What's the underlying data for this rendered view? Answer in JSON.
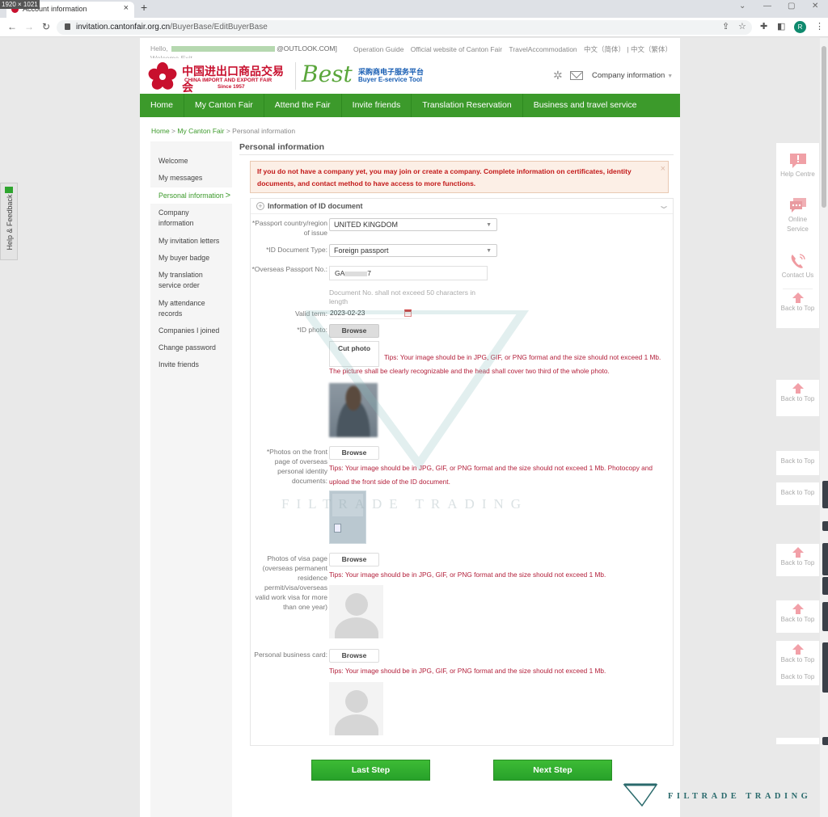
{
  "browser": {
    "dims_badge": "1920 × 1021",
    "tab_title": "Account information",
    "url_host": "invitation.cantonfair.org.cn",
    "url_path": "/BuyerBase/EditBuyerBase",
    "profile_initial": "R"
  },
  "topbar": {
    "hello": "Hello,",
    "email_suffix": "@OUTLOOK.COM]",
    "welcome": "Welcome Exit",
    "links": [
      "Operation Guide",
      "Official website of Canton Fair",
      "TravelAccommodation",
      "中文（简体）",
      "| 中文（繁体）"
    ]
  },
  "header": {
    "logo_cn": "中国进出口商品交易会",
    "logo_en": "CHINA IMPORT AND EXPORT FAIR",
    "logo_since": "Since 1957",
    "best": "Best",
    "best_cn": "采购商电子服务平台",
    "best_en": "Buyer E-service Tool",
    "company_menu": "Company information"
  },
  "mainnav": [
    "Home",
    "My Canton Fair",
    "Attend the Fair",
    "Invite friends",
    "Translation Reservation",
    "Business and travel service"
  ],
  "breadcrumb": {
    "home": "Home",
    "sep": " > ",
    "section": "My Canton Fair",
    "current": "Personal information"
  },
  "sidebar": {
    "items": [
      "Welcome",
      "My messages",
      "Personal information",
      "Company information",
      "My invitation letters",
      "My buyer badge",
      "My translation service order",
      "My attendance records",
      "Companies I joined",
      "Change password",
      "Invite friends"
    ],
    "active": "Personal information"
  },
  "content": {
    "title": "Personal information",
    "alert": "If you do not have a company yet, you may join or create a company. Complete information on certificates, identity documents, and contact method to have access to more functions.",
    "panel_title": "Information of ID document",
    "fields": {
      "country_label": "*Passport country/region of issue",
      "country_value": "UNITED KINGDOM",
      "doctype_label": "*ID Document Type:",
      "doctype_value": "Foreign passport",
      "passport_label": "*Overseas Passport No.:",
      "passport_prefix": "GA",
      "passport_suffix": "7",
      "passport_hint": "Document No. shall not exceed 50 characters in length",
      "valid_label": "Valid term:",
      "valid_value": "2023-02-23",
      "idphoto_label": "*ID photo:",
      "idphoto_tips": "Tips: Your image should be in JPG, GIF, or PNG format and the size should not exceed 1 Mb. The picture shall be clearly recognizable and the head shall cover two third of the whole photo.",
      "front_label": "*Photos on the front page of overseas personal identity documents:",
      "front_tips": "Tips: Your image should be in JPG, GIF, or PNG format and the size should not exceed 1 Mb. Photocopy and upload the front side of the ID document.",
      "visa_label": "Photos of visa page (overseas permanent residence permit/visa/overseas valid work visa for more than one year)",
      "visa_tips": "Tips: Your image should be in JPG, GIF, or PNG format and the size should not exceed 1 Mb.",
      "card_label": "Personal business card:",
      "card_tips": "Tips: Your image should be in JPG, GIF, or PNG format and the size should not exceed 1 Mb."
    },
    "browse_label": "Browse",
    "cut_label": "Cut photo",
    "last_step": "Last Step",
    "next_step": "Next Step"
  },
  "rfloat": {
    "help": "Help Centre",
    "online": "Online Service",
    "contact": "Contact Us",
    "back_to_top": "Back to Top"
  },
  "feedback": "Help & Feedback",
  "watermark": "FILTRADE TRADING",
  "colors": {
    "brand_green": "#3c9a2b",
    "alert_red": "#c21818",
    "tips_red": "#b3203b",
    "fair_red": "#c8102e"
  }
}
